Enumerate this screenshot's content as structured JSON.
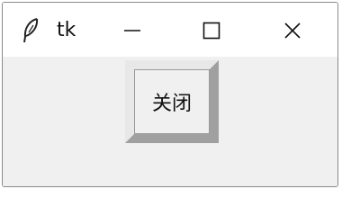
{
  "window": {
    "title": "tk",
    "icon": "feather-icon",
    "controls": {
      "minimize_icon": "minimize-icon",
      "maximize_icon": "maximize-icon",
      "close_icon": "close-icon"
    }
  },
  "main": {
    "close_button_label": "关闭"
  },
  "colors": {
    "titlebar_bg": "#ffffff",
    "window_bg": "#f0f0f0",
    "text": "#111111"
  }
}
